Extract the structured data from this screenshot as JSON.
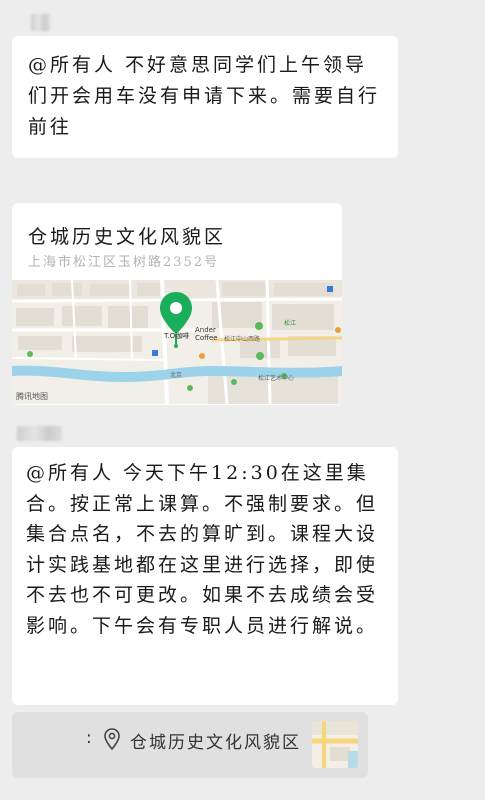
{
  "message1": {
    "text": "@所有人 不好意思同学们上午领导们开会用车没有申请下来。需要自行前往"
  },
  "map_card": {
    "title": "仓城历史文化风貌区",
    "address": "上海市松江区玉树路2352号",
    "watermark": "腾讯地图",
    "labels": {
      "anderc": "Ander",
      "coffee": "Coffee",
      "to_cafe": "T.O咖啡",
      "songjiang": "松江中山西路",
      "arts_center": "松江艺术中心",
      "school": "松江",
      "north": "北京"
    }
  },
  "message2": {
    "text": "@所有人 今天下午12:30在这里集合。按正常上课算。不强制要求。但集合点名，不去的算旷到。课程大设计实践基地都在这里进行选择，即使不去也不可更改。如果不去成绩会受影响。下午会有专职人员进行解说。"
  },
  "location_message": {
    "colon": ":",
    "text": "仓城历史文化风貌区",
    "icon": "location-pin-icon"
  },
  "colors": {
    "background": "#ededed",
    "bubble": "#ffffff",
    "map_pin": "#1aad5a",
    "map_river": "#9dd3ea"
  }
}
